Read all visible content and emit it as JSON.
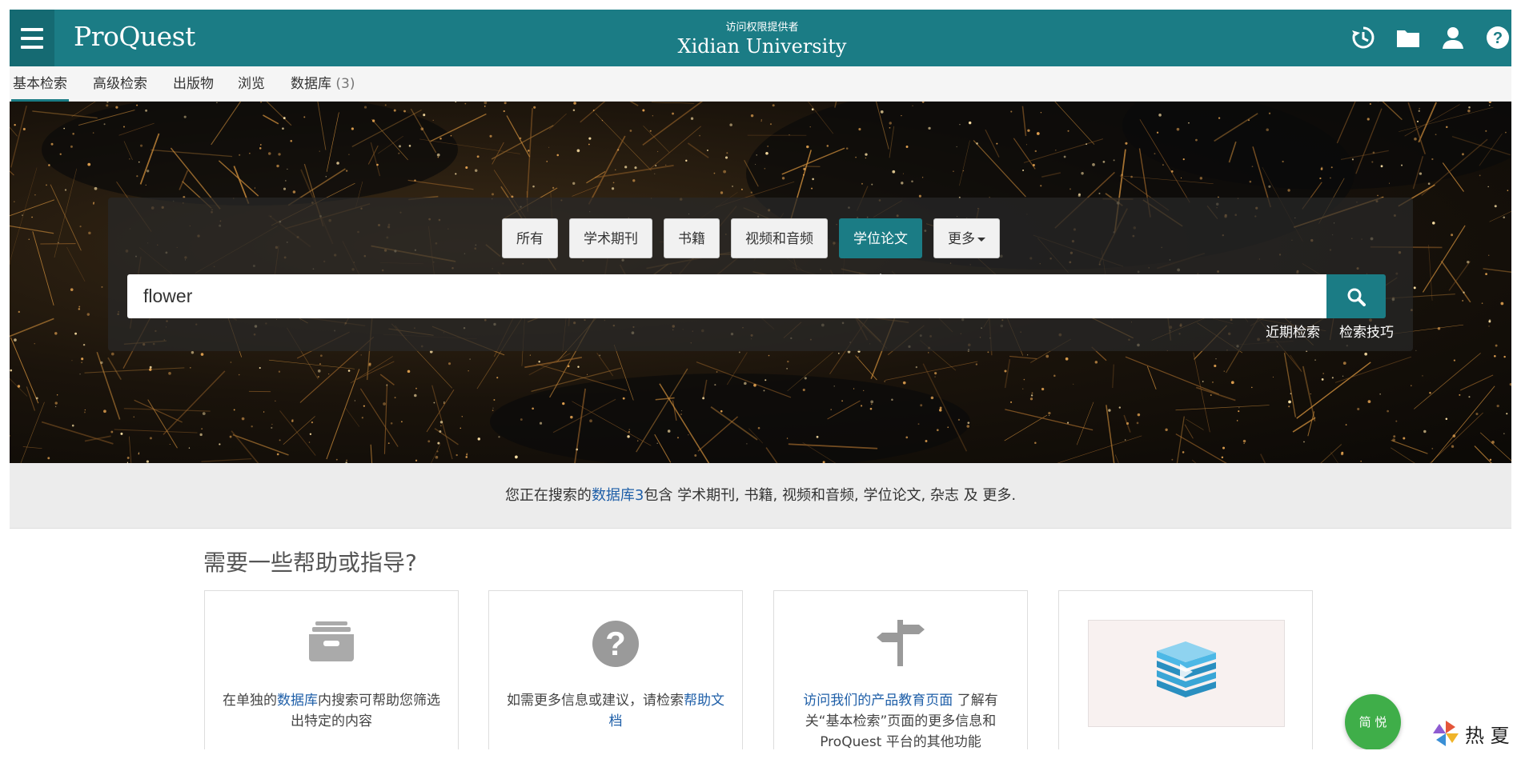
{
  "header": {
    "logo": "ProQuest",
    "provider_label": "访问权限提供者",
    "provider_name": "Xidian University",
    "icons": [
      "history-icon",
      "folder-icon",
      "user-icon",
      "help-icon"
    ],
    "color": "#1b7c85"
  },
  "nav": {
    "items": [
      {
        "label": "基本检索",
        "active": true
      },
      {
        "label": "高级检索"
      },
      {
        "label": "出版物"
      },
      {
        "label": "浏览"
      },
      {
        "label": "数据库"
      }
    ],
    "db_count": "(3)"
  },
  "search": {
    "tabs": [
      "所有",
      "学术期刊",
      "书籍",
      "视频和音频",
      "学位论文",
      "更多"
    ],
    "active_tab": "学位论文",
    "query": "flower",
    "recent_link": "近期检索",
    "tips_link": "检索技巧"
  },
  "info": {
    "prefix": "您正在搜索的",
    "db_link": "数据库3",
    "suffix": "包含 学术期刊, 书籍, 视频和音频, 学位论文, 杂志 及 更多."
  },
  "help": {
    "title": "需要一些帮助或指导?",
    "cards": [
      {
        "icon": "archive-box-icon",
        "before": "在单独的",
        "link": "数据库",
        "after": "内搜索可帮助您筛选出特定的内容"
      },
      {
        "icon": "question-circle-icon",
        "before": "如需更多信息或建议，请检索",
        "link": "帮助文档",
        "after": ""
      },
      {
        "icon": "signpost-icon",
        "before": "",
        "link": "访问我们的产品教育页面",
        "after": " 了解有关“基本检索”页面的更多信息和 ProQuest 平台的其他功能"
      },
      {
        "icon": "video-thumbnail-icon"
      }
    ]
  },
  "reader_button": "简 悦",
  "watermark": "热 夏"
}
